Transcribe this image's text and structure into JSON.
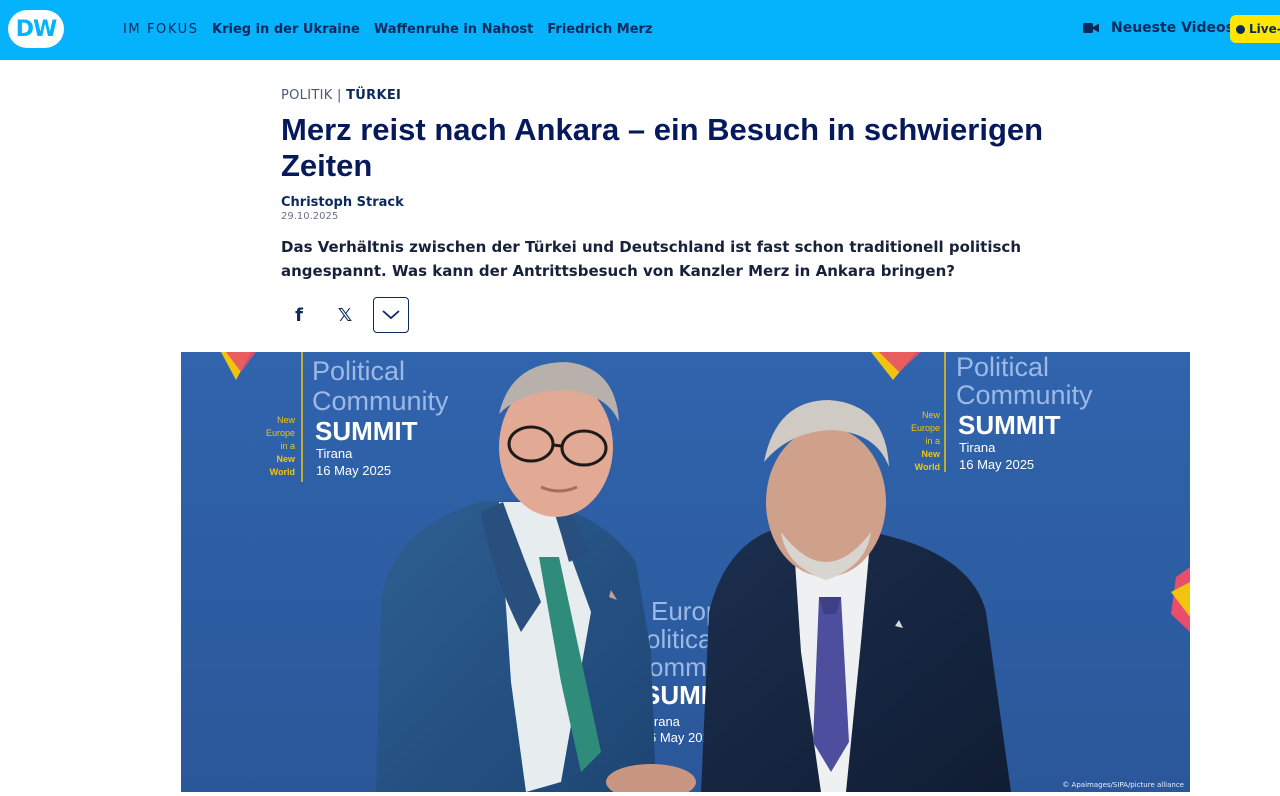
{
  "header": {
    "logo": "DW",
    "focus_label": "IM FOKUS",
    "topics": [
      "Krieg in der Ukraine",
      "Waffenruhe in Nahost",
      "Friedrich Merz"
    ],
    "videos_label": "Neueste Videos",
    "live_label": "Live-",
    "colors": {
      "brand": "#05b2fc",
      "live": "#ffe600",
      "text": "#0b2a5b"
    }
  },
  "article": {
    "kicker_section": "POLITIK",
    "kicker_separator": "|",
    "kicker_tag": "TÜRKEI",
    "headline": "Merz reist nach Ankara – ein Besuch in schwierigen Zeiten",
    "author": "Christoph Strack",
    "date": "29.10.2025",
    "teaser": "Das Verhältnis zwischen der Türkei und Deutschland ist fast schon traditionell politisch angespannt. Was kann der Antrittsbesuch von Kanzler Merz in Ankara bringen?",
    "share": {
      "facebook_icon": "f",
      "x_icon": "𝕏",
      "more_icon": "﹀"
    }
  },
  "photo": {
    "backdrop_left": {
      "line1": "Political",
      "line2": "Community",
      "line3": "SUMMIT",
      "place": "Tirana",
      "date": "16 May 2025",
      "slogan": [
        "New",
        "Europe",
        "in a",
        "New",
        "World"
      ]
    },
    "backdrop_right": {
      "line1": "Political",
      "line2": "Community",
      "line3": "SUMMIT",
      "place": "Tirana",
      "date": "16 May 2025",
      "slogan": [
        "New",
        "Europe",
        "in a",
        "New",
        "World"
      ]
    },
    "backdrop_center": {
      "line1": "Europ",
      "line2": "olitica",
      "line3": "ommu",
      "line4": "SUMMI",
      "place": "irana",
      "date": "6 May 2025"
    },
    "credit": "© Apaimages/SIPA/picture alliance"
  }
}
